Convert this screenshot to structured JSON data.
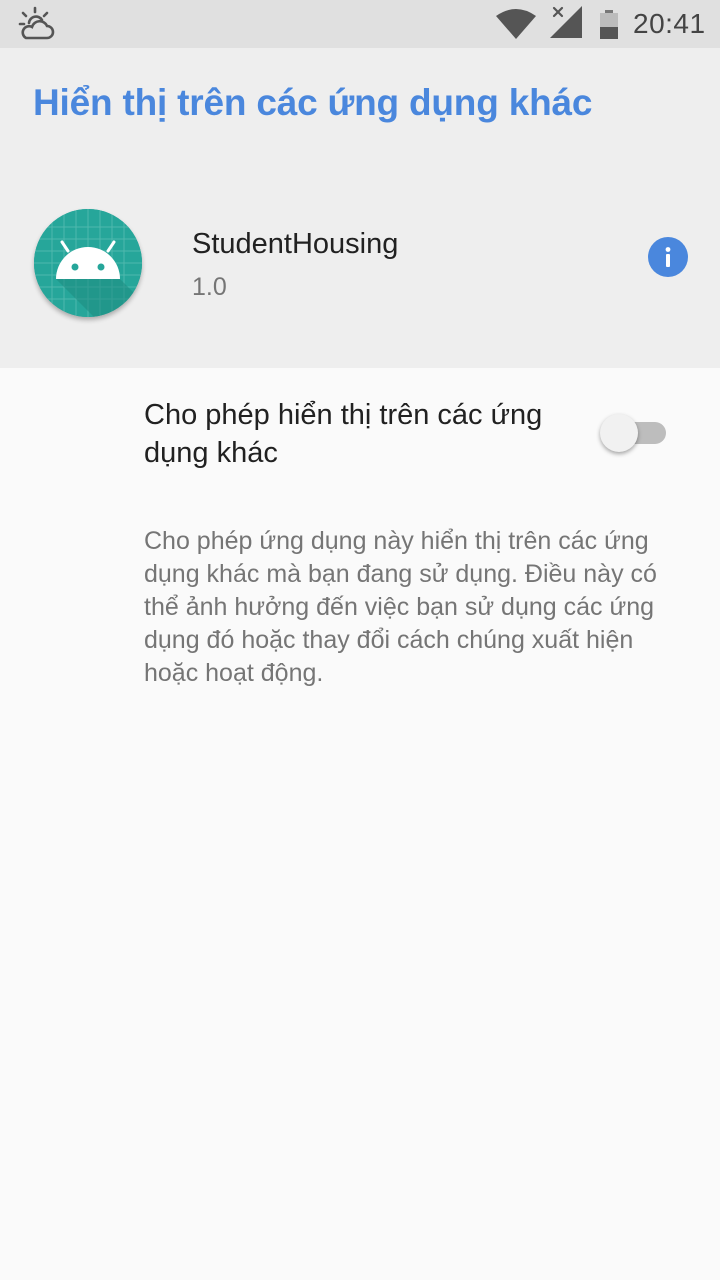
{
  "status_bar": {
    "time": "20:41",
    "icons": [
      "weather-partly-cloudy-icon",
      "wifi-icon",
      "signal-no-service-icon",
      "battery-icon"
    ]
  },
  "header": {
    "title": "Hiển thị trên các ứng dụng khác",
    "title_color": "#4a87dd",
    "app": {
      "name": "StudentHousing",
      "version": "1.0",
      "icon": "android-icon",
      "icon_color": "#26a69a"
    },
    "info_icon": "info-icon"
  },
  "setting": {
    "title": "Cho phép hiển thị trên các ứng dụng khác",
    "toggle_on": false,
    "description": "Cho phép ứng dụng này hiển thị trên các ứng dụng khác mà bạn đang sử dụng. Điều này có thể ảnh hưởng đến việc bạn sử dụng các ứng dụng đó hoặc thay đổi cách chúng xuất hiện hoặc hoạt động."
  }
}
